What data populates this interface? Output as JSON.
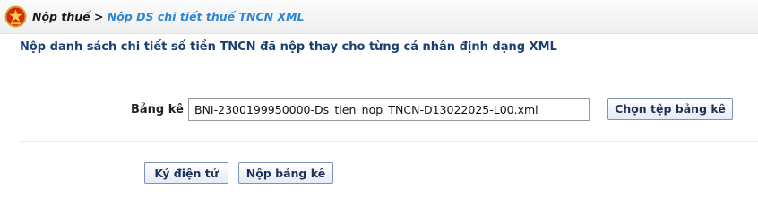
{
  "header": {
    "emblem_icon": "national-emblem-icon",
    "breadcrumb": {
      "root": "Nộp thuế",
      "separator": " > ",
      "current": "Nộp DS chi tiết thuế TNCN XML"
    },
    "colors": {
      "breadcrumb_current": "#2e86d4",
      "title": "#1c3f73"
    }
  },
  "main": {
    "title": "Nộp danh sách chi tiết số tiền TNCN đã nộp thay cho từng cá nhân định dạng XML",
    "form": {
      "file_label": "Bảng kê",
      "file_value": "BNI-2300199950000-Ds_tien_nop_TNCN-D13022025-L00.xml",
      "choose_file_button": "Chọn tệp bảng kê"
    },
    "actions": {
      "sign_button": "Ký điện tử",
      "submit_button": "Nộp bảng kê"
    }
  }
}
